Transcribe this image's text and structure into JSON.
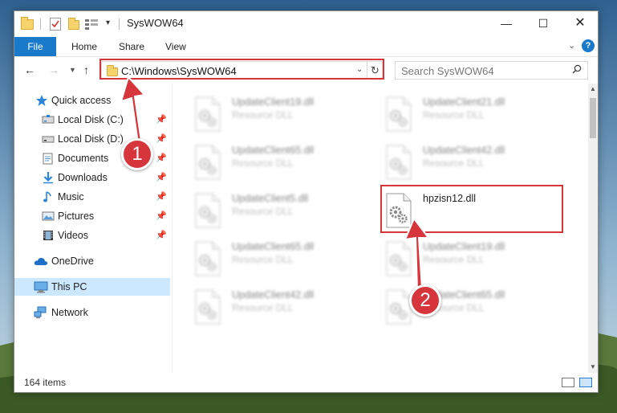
{
  "window": {
    "title": "SysWOW64",
    "minimize_glyph": "—",
    "maximize_glyph": "☐",
    "close_glyph": "✕"
  },
  "ribbon": {
    "tabs": [
      "File",
      "Home",
      "Share",
      "View"
    ],
    "help": "?"
  },
  "address_bar": {
    "path": "C:\\Windows\\SysWOW64",
    "refresh_glyph": "↻"
  },
  "search": {
    "placeholder": "Search SysWOW64"
  },
  "sidebar": {
    "items": [
      {
        "label": "Quick access",
        "icon": "star-icon",
        "pinned": false
      },
      {
        "label": "Local Disk (C:)",
        "icon": "drive-icon",
        "pinned": true
      },
      {
        "label": "Local Disk (D:)",
        "icon": "drive-icon",
        "pinned": true
      },
      {
        "label": "Documents",
        "icon": "documents-icon",
        "pinned": true
      },
      {
        "label": "Downloads",
        "icon": "download-icon",
        "pinned": true
      },
      {
        "label": "Music",
        "icon": "music-icon",
        "pinned": true
      },
      {
        "label": "Pictures",
        "icon": "pictures-icon",
        "pinned": true
      },
      {
        "label": "Videos",
        "icon": "videos-icon",
        "pinned": true
      },
      {
        "label": "OneDrive",
        "icon": "cloud-icon",
        "pinned": false
      },
      {
        "label": "This PC",
        "icon": "computer-icon",
        "pinned": false,
        "selected": true
      },
      {
        "label": "Network",
        "icon": "network-icon",
        "pinned": false
      }
    ]
  },
  "files": [
    {
      "name": "UpdateClient19.dll",
      "type": "Resource DLL",
      "blurred": true
    },
    {
      "name": "UpdateClient21.dll",
      "type": "Resource DLL",
      "blurred": true
    },
    {
      "name": "UpdateClient65.dll",
      "type": "Resource DLL",
      "blurred": true
    },
    {
      "name": "UpdateClient42.dll",
      "type": "Resource DLL",
      "blurred": true
    },
    {
      "name": "UpdateClient5.dll",
      "type": "Resource DLL",
      "blurred": true
    },
    {
      "name": "hpzisn12.dll",
      "type": "",
      "blurred": false
    },
    {
      "name": "UpdateClient65.dll",
      "type": "Resource DLL",
      "blurred": true
    },
    {
      "name": "UpdateClient19.dll",
      "type": "Resource DLL",
      "blurred": true
    },
    {
      "name": "UpdateClient42.dll",
      "type": "Resource DLL",
      "blurred": true
    },
    {
      "name": "UpdateClient65.dll",
      "type": "Resource DLL",
      "blurred": true
    }
  ],
  "status": {
    "item_count": "164 items"
  },
  "annotations": {
    "step1": "1",
    "step2": "2",
    "color": "#d6353b"
  }
}
